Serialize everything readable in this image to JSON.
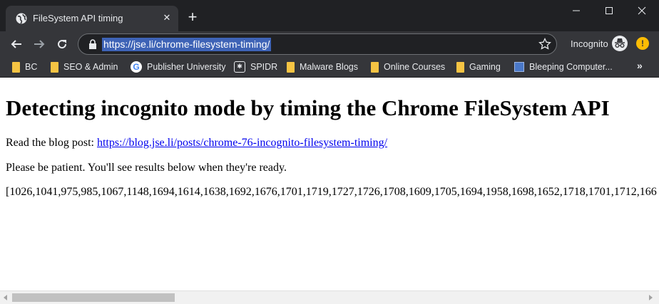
{
  "browser": {
    "tab": {
      "title": "FileSystem API timing",
      "favicon": "globe-icon",
      "close_glyph": "✕"
    },
    "new_tab_glyph": "+",
    "window_controls": [
      "minimize-icon",
      "maximize-icon",
      "close-icon"
    ],
    "toolbar": {
      "back": "back-arrow-icon",
      "forward": "forward-arrow-icon",
      "reload": "reload-icon",
      "url": "https://jse.li/chrome-filesystem-timing/",
      "incognito_label": "Incognito",
      "extension_glyph": "!"
    },
    "bookmarks": [
      {
        "label": "BC",
        "icon": "folder"
      },
      {
        "label": "SEO & Admin",
        "icon": "folder"
      },
      {
        "label": "Publisher University",
        "icon": "google"
      },
      {
        "label": "SPIDR",
        "icon": "spidr"
      },
      {
        "label": "Malware Blogs",
        "icon": "folder"
      },
      {
        "label": "Online Courses",
        "icon": "folder"
      },
      {
        "label": "Gaming",
        "icon": "folder"
      },
      {
        "label": "Bleeping Computer...",
        "icon": "site"
      }
    ],
    "bookmarks_overflow": "»"
  },
  "page": {
    "heading": "Detecting incognito mode by timing the Chrome FileSystem API",
    "blog_prefix": "Read the blog post: ",
    "blog_link": "https://blog.jse.li/posts/chrome-76-incognito-filesystem-timing/",
    "patience_text": "Please be patient. You'll see results below when they're ready.",
    "results_text": "[1026,1041,975,985,1067,1148,1694,1614,1638,1692,1676,1701,1719,1727,1726,1708,1609,1705,1694,1958,1698,1652,1718,1701,1712,166"
  },
  "colors": {
    "tabstrip": "#202124",
    "toolbar": "#35363a",
    "url_selection": "#3e63b6",
    "link": "#0000ee",
    "folder": "#f6c443"
  }
}
